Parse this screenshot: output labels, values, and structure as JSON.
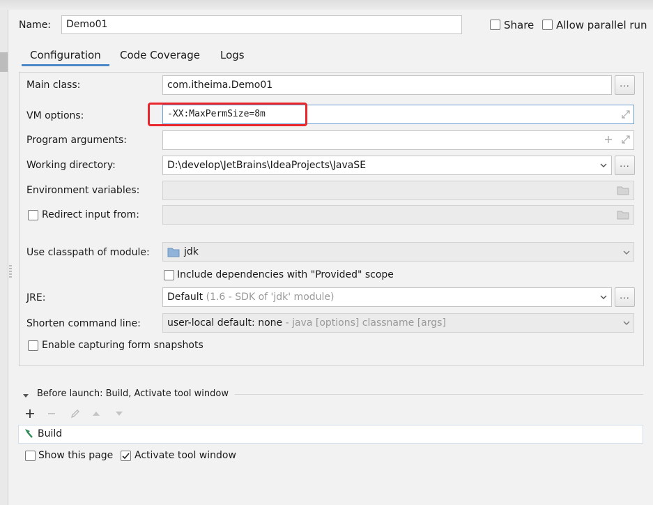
{
  "header": {
    "name_label": "Name:",
    "name_value": "Demo01",
    "share_label": "Share",
    "parallel_label": "Allow parallel run"
  },
  "tabs": [
    {
      "label": "Configuration",
      "active": true
    },
    {
      "label": "Code Coverage",
      "active": false
    },
    {
      "label": "Logs",
      "active": false
    }
  ],
  "form": {
    "main_class_label": "Main class:",
    "main_class_value": "com.itheima.Demo01",
    "vm_options_label": "VM options:",
    "vm_options_value": "-XX:MaxPermSize=8m",
    "program_args_label": "Program arguments:",
    "program_args_value": "",
    "working_dir_label": "Working directory:",
    "working_dir_value": "D:\\develop\\JetBrains\\IdeaProjects\\JavaSE",
    "env_vars_label": "Environment variables:",
    "env_vars_value": "",
    "redirect_label": "Redirect input from:",
    "redirect_value": "",
    "classpath_label": "Use classpath of module:",
    "classpath_value": "jdk",
    "include_deps_label": "Include dependencies with \"Provided\" scope",
    "jre_label": "JRE:",
    "jre_value": "Default",
    "jre_hint": "(1.6 - SDK of 'jdk' module)",
    "shorten_label": "Shorten command line:",
    "shorten_value": "user-local default: none",
    "shorten_hint": "- java [options] classname [args]",
    "snapshots_label": "Enable capturing form snapshots",
    "ellipsis": "..."
  },
  "before_launch": {
    "title": "Before launch: Build, Activate tool window",
    "items": [
      "Build"
    ],
    "show_page_label": "Show this page",
    "activate_label": "Activate tool window",
    "activate_checked": true
  },
  "colors": {
    "highlight": "#e8262b",
    "tab_underline": "#4a88c7",
    "build_icon": "#2e8b57"
  }
}
